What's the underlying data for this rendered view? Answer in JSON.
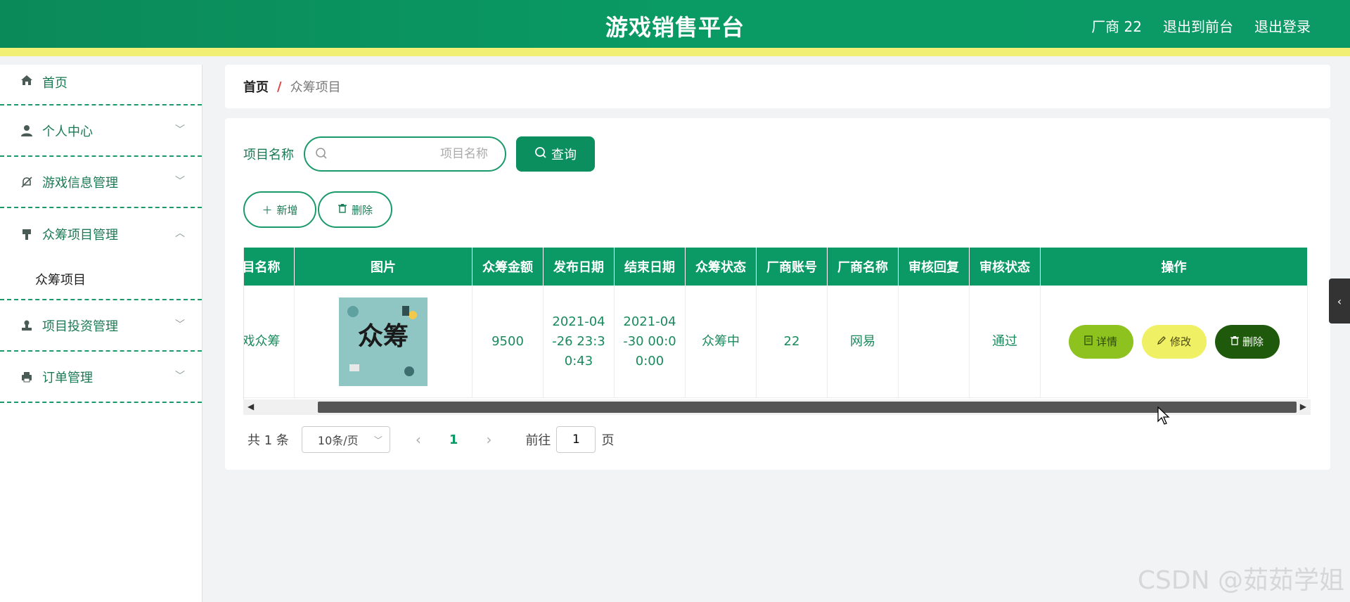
{
  "header": {
    "title": "游戏销售平台",
    "links": [
      "厂商 22",
      "退出到前台",
      "退出登录"
    ]
  },
  "sidebar": {
    "items": [
      {
        "label": "首页",
        "icon": "home-icon"
      },
      {
        "label": "个人中心",
        "icon": "user-icon"
      },
      {
        "label": "游戏信息管理",
        "icon": "bell-off-icon"
      },
      {
        "label": "众筹项目管理",
        "icon": "brush-icon",
        "sub": "众筹项目"
      },
      {
        "label": "项目投资管理",
        "icon": "stamp-icon"
      },
      {
        "label": "订单管理",
        "icon": "printer-icon"
      }
    ]
  },
  "breadcrumb": {
    "home": "首页",
    "sep": "/",
    "current": "众筹项目"
  },
  "search": {
    "label": "项目名称",
    "placeholder": "项目名称",
    "button": "查询"
  },
  "actions": {
    "add": "新增",
    "delete": "删除"
  },
  "table": {
    "headers": [
      "项目名称",
      "图片",
      "众筹金额",
      "发布日期",
      "结束日期",
      "众筹状态",
      "厂商账号",
      "厂商名称",
      "审核回复",
      "审核状态",
      "操作"
    ],
    "row": {
      "name": "游戏众筹",
      "image_text": "众筹",
      "amount": "9500",
      "publish_date": "2021-04-26 23:30:43",
      "end_date": "2021-04-30 00:00:00",
      "status": "众筹中",
      "vendor_account": "22",
      "vendor_name": "网易",
      "review_reply": "",
      "review_status": "通过"
    },
    "ops": {
      "detail": "详情",
      "edit": "修改",
      "delete": "删除"
    }
  },
  "pagination": {
    "total": "共 1 条",
    "page_size": "10条/页",
    "current": "1",
    "goto_label": "前往",
    "goto_value": "1",
    "page_suffix": "页"
  },
  "watermark": "CSDN @茹茹学姐",
  "colors": {
    "primary": "#0b9a66",
    "accent_yellow": "#f1f075",
    "detail_btn": "#8ec21f",
    "edit_btn": "#f0f064",
    "delete_btn": "#1f5a0c"
  }
}
